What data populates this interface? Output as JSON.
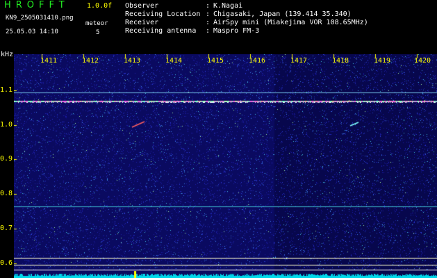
{
  "header": {
    "logo": "HROFFT",
    "version": "1.0.0f",
    "filename": "KN9_2505031410.png",
    "datetime": "25.05.03 14:10",
    "meteor_label": "meteor",
    "meteor_count": "5",
    "info": [
      {
        "key": "Observer",
        "value": "K.Nagai"
      },
      {
        "key": "Receiving Location",
        "value": "Chigasaki, Japan (139.414 35.340)"
      },
      {
        "key": "Receiver",
        "value": "AirSpy mini (Miakejima VOR 108.65MHz)"
      },
      {
        "key": "Receiving antenna",
        "value": "Maspro FM-3"
      }
    ]
  },
  "axes": {
    "y_unit": "kHz",
    "x_ticks": [
      "1411",
      "1412",
      "1413",
      "1414",
      "1415",
      "1416",
      "1417",
      "1418",
      "1419",
      "1420"
    ],
    "y_ticks": [
      "1.1",
      "1.0",
      "0.9",
      "0.8",
      "0.7",
      "0.6"
    ]
  },
  "colors": {
    "background": "#000000",
    "label": "#ffff00",
    "logo": "#22ee22",
    "text": "#ffffff",
    "noise_low": "#1a1aa8",
    "carrier": "#ff99ff",
    "floor": "#00ddee"
  }
}
